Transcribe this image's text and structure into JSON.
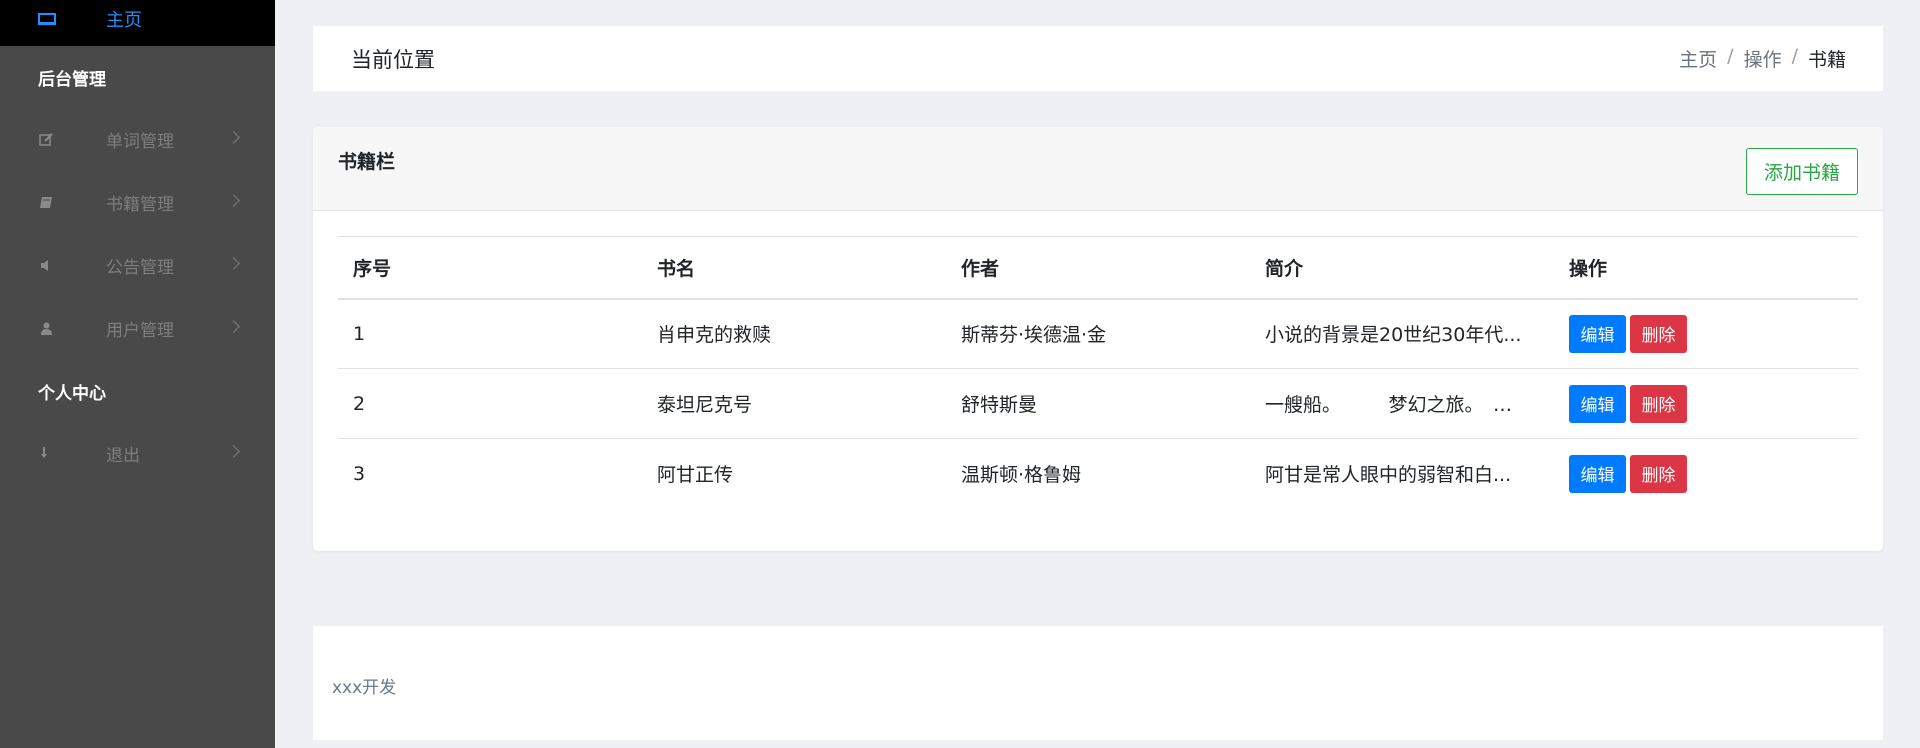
{
  "sidebar": {
    "home_label": "主页",
    "section1": "后台管理",
    "items": [
      {
        "label": "单词管理",
        "icon": "edit-icon"
      },
      {
        "label": "书籍管理",
        "icon": "book-icon"
      },
      {
        "label": "公告管理",
        "icon": "speaker-icon"
      },
      {
        "label": "用户管理",
        "icon": "user-icon"
      }
    ],
    "section2": "个人中心",
    "logout_label": "退出"
  },
  "header": {
    "title": "当前位置",
    "breadcrumb": [
      "主页",
      "操作",
      "书籍"
    ],
    "separator": "/"
  },
  "books_card": {
    "title": "书籍栏",
    "add_button": "添加书籍",
    "columns": [
      "序号",
      "书名",
      "作者",
      "简介",
      "操作"
    ],
    "rows": [
      {
        "id": "1",
        "name": "肖申克的救赎",
        "author": "斯蒂芬·埃德温·金",
        "intro": "小说的背景是20世纪30年代..."
      },
      {
        "id": "2",
        "name": "泰坦尼克号",
        "author": "舒特斯曼",
        "intro": "一艘船。　　　梦幻之旅。　　..."
      },
      {
        "id": "3",
        "name": "阿甘正传",
        "author": "温斯顿·格鲁姆",
        "intro": "阿甘是常人眼中的弱智和白..."
      }
    ],
    "edit_label": "编辑",
    "delete_label": "删除"
  },
  "footer": {
    "text": "xxx开发"
  },
  "colors": {
    "accent": "#1e90ff",
    "sidebar_bg": "#494949",
    "edit": "#007bff",
    "delete": "#dc3545",
    "add": "#28a745"
  }
}
